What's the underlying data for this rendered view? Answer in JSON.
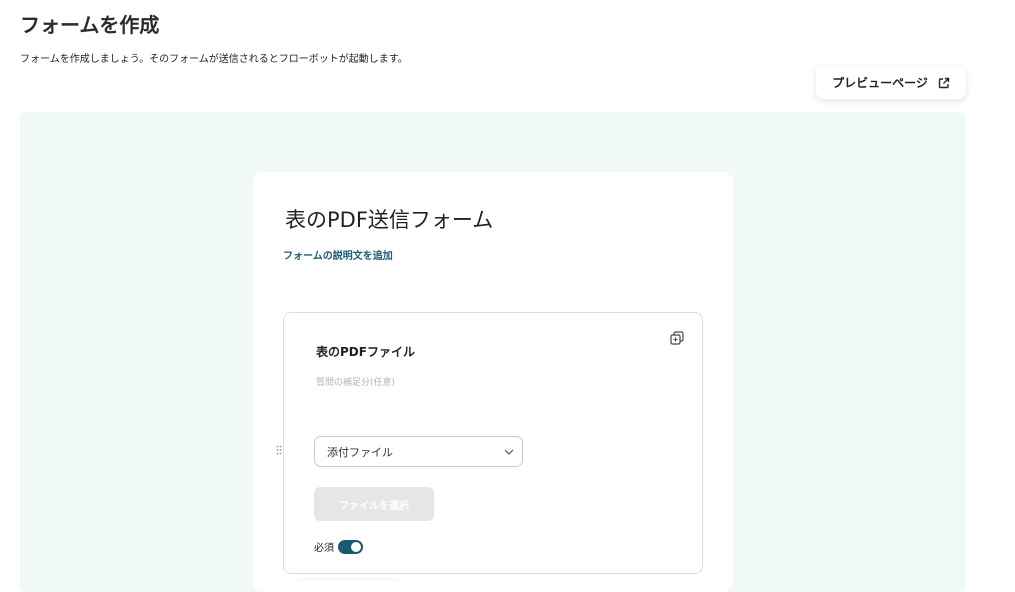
{
  "page": {
    "title": "フォームを作成",
    "subtitle": "フォームを作成しましょう。そのフォームが送信されるとフローボットが起動します。"
  },
  "toolbar": {
    "preview_label": "プレビューページ",
    "preview_icon": "external-link-icon"
  },
  "form": {
    "title": "表のPDF送信フォーム",
    "add_description_label": "フォームの説明文を追加"
  },
  "question": {
    "label": "表のPDFファイル",
    "help_placeholder": "質問の補足分(任意)",
    "type_value": "添付ファイル",
    "file_button_label": "ファイルを選択",
    "required_label": "必須",
    "required": true
  },
  "colors": {
    "accent": "#1a5b6e",
    "canvas_bg": "#f1f9f8"
  }
}
